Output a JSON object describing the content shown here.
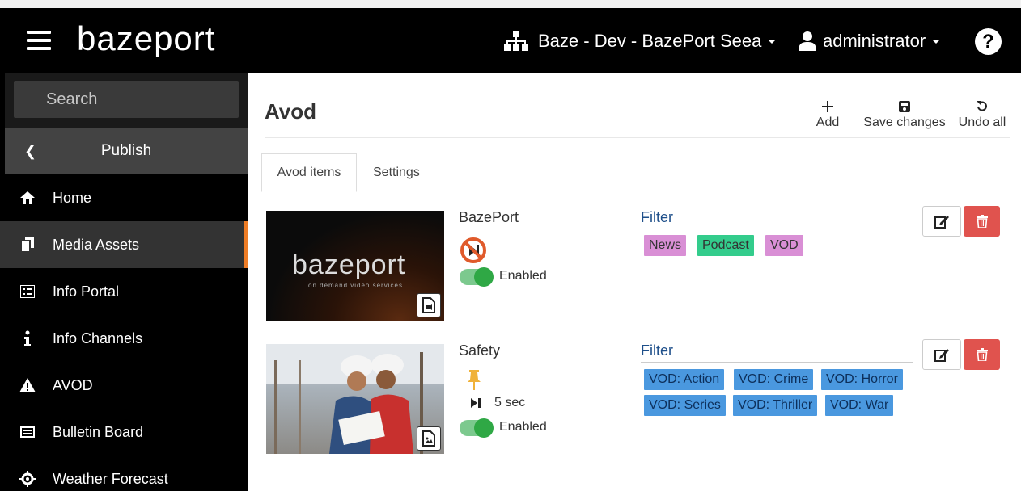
{
  "header": {
    "logo": "bazeport",
    "site": "Baze - Dev - BazePort Seea",
    "user": "administrator",
    "help": "?"
  },
  "sidebar": {
    "search_placeholder": "Search",
    "section": "Publish",
    "items": [
      {
        "label": "Home",
        "icon": "home-icon"
      },
      {
        "label": "Media Assets",
        "icon": "copy-icon",
        "active": true
      },
      {
        "label": "Info Portal",
        "icon": "list-icon"
      },
      {
        "label": "Info Channels",
        "icon": "info-icon"
      },
      {
        "label": "AVOD",
        "icon": "warning-icon"
      },
      {
        "label": "Bulletin Board",
        "icon": "board-icon"
      },
      {
        "label": "Weather Forecast",
        "icon": "cog-icon"
      }
    ]
  },
  "main": {
    "title": "Avod",
    "toolbar": {
      "add": "Add",
      "save": "Save changes",
      "undo": "Undo all"
    },
    "tabs": [
      "Avod items",
      "Settings"
    ],
    "items": [
      {
        "name": "BazePort",
        "thumb_logo": "bazeport",
        "thumb_sub": "on demand video services",
        "status": "Enabled",
        "filter_label": "Filter",
        "tags": [
          "News",
          "Podcast",
          "VOD"
        ]
      },
      {
        "name": "Safety",
        "duration": "5 sec",
        "status": "Enabled",
        "filter_label": "Filter",
        "tags": [
          "VOD: Action",
          "VOD: Crime",
          "VOD: Horror",
          "VOD: Series",
          "VOD: Thriller",
          "VOD: War"
        ]
      }
    ]
  },
  "colors": {
    "accent": "#ee7d26",
    "danger": "#e0534e",
    "toggle": "#2fa845",
    "filter_title": "#1e4f8a",
    "tag_pink": "#d98fd5",
    "tag_green": "#33cc8c",
    "tag_blue": "#4a98df"
  }
}
